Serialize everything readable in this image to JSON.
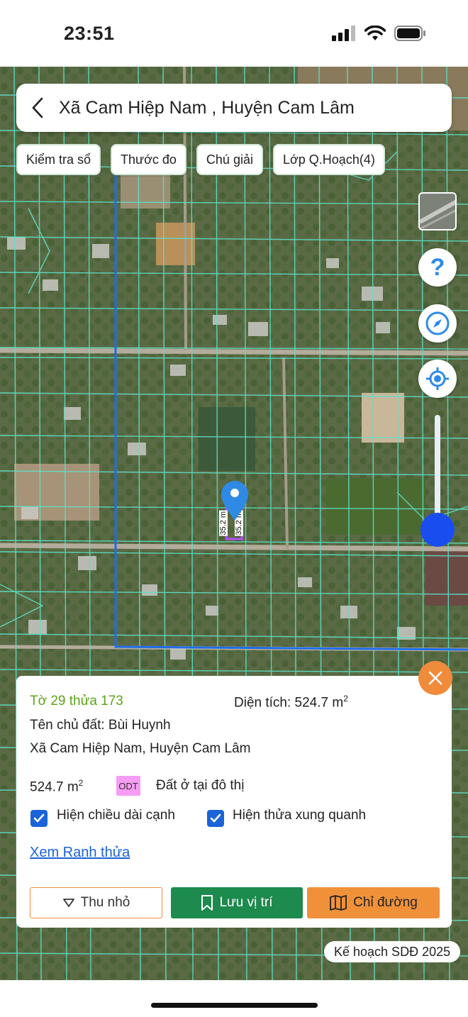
{
  "status": {
    "time": "23:51"
  },
  "header": {
    "title": "Xã Cam Hiệp Nam , Huyện Cam Lâm",
    "back_icon": "chevron-left-icon"
  },
  "chips": [
    "Kiểm tra sổ",
    "Thước đo",
    "Chú giải",
    "Lớp Q.Hoạch(4)"
  ],
  "map": {
    "dimension_labels": [
      "35.2 m",
      "35.2 m"
    ],
    "colors": {
      "parcel_lines": "#5fe0c8",
      "boundary": "#1f6de8",
      "highlight": "#b84dff"
    },
    "plan_label": "Kế hoạch SDĐ 2025",
    "controls": {
      "help": "?",
      "compass_icon": "compass-icon",
      "locate_icon": "crosshair-icon"
    }
  },
  "panel": {
    "sheet": "Tờ 29 thửa 173",
    "area_label": "Diện tích: 524.7 m",
    "area_sup": "2",
    "owner": "Tên chủ đất: Bùi Huynh",
    "address": "Xã Cam Hiệp Nam, Huyện Cam Lâm",
    "land_area": "524.7 m",
    "land_area_sup": "2",
    "land_code": "ODT",
    "land_type": "Đất ở tại đô thị",
    "checkbox_edges": "Hiện chiều dài cạnh",
    "checkbox_neighbors": "Hiện thửa xung quanh",
    "link": "Xem Ranh thửa",
    "buttons": {
      "shrink": "Thu nhỏ",
      "save": "Lưu vị trí",
      "route": "Chỉ đường"
    },
    "colors": {
      "code_badge": "#f79cf5",
      "save": "#1d8a4e",
      "route": "#f0913a",
      "close": "#f08b3c"
    }
  }
}
